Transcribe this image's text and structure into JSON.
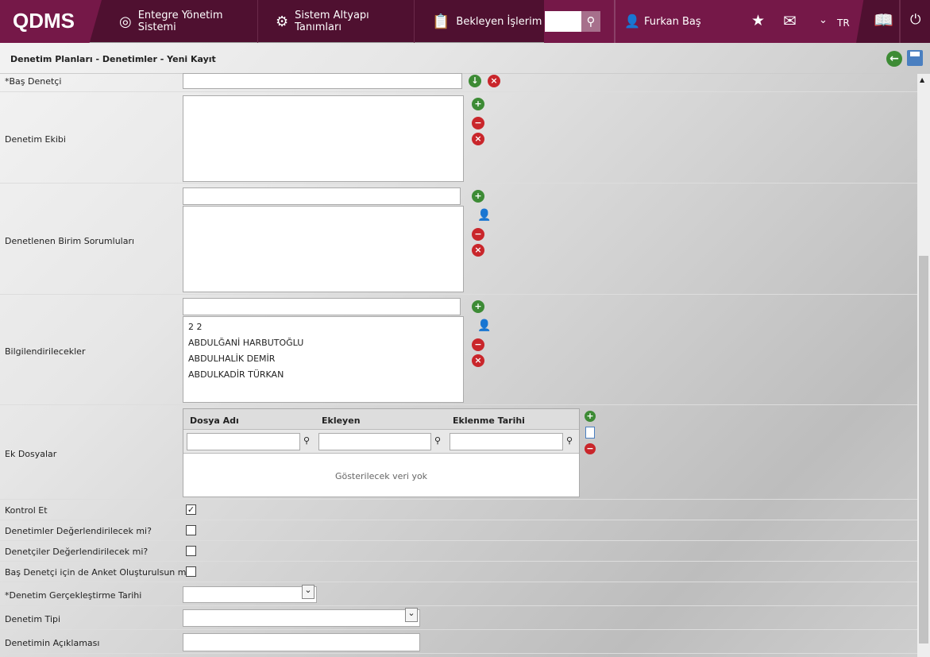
{
  "header": {
    "logo": "QDMS",
    "nav": [
      {
        "label": "Entegre Yönetim Sistemi",
        "icon": "q-icon"
      },
      {
        "label": "Sistem Altyapı Tanımları",
        "icon": "gear-icon"
      },
      {
        "label": "Bekleyen İşlerim",
        "icon": "clipboard-icon"
      }
    ],
    "search_value": "",
    "user": "Furkan Baş",
    "lang": "TR"
  },
  "title": "Denetim Planları - Denetimler - Yeni Kayıt",
  "form": {
    "bas_denetci": "*Baş Denetçi",
    "denetim_ekibi": "Denetim Ekibi",
    "denetlenen": "Denetlenen Birim Sorumluları",
    "bilgilendirilecekler": "Bilgilendirilecekler",
    "bilgi_items": [
      "2 2",
      "ABDULĞANİ HARBUTOĞLU",
      "ABDULHALİK DEMİR",
      "ABDULKADİR TÜRKAN"
    ],
    "ek_dosyalar": "Ek Dosyalar",
    "grid": {
      "columns": [
        "Dosya Adı",
        "Ekleyen",
        "Eklenme Tarihi"
      ],
      "empty": "Gösterilecek veri yok"
    },
    "kontrol_et": "Kontrol Et",
    "kontrol_et_checked": true,
    "denetimler_deg": "Denetimler Değerlendirilecek mi?",
    "denetciler_deg": "Denetçiler Değerlendirilecek mi?",
    "anket": "Baş Denetçi için de Anket Oluşturulsun mu?",
    "tarih": "*Denetim Gerçekleştirme Tarihi",
    "tipi": "Denetim Tipi",
    "aciklama": "Denetimin Açıklaması"
  }
}
